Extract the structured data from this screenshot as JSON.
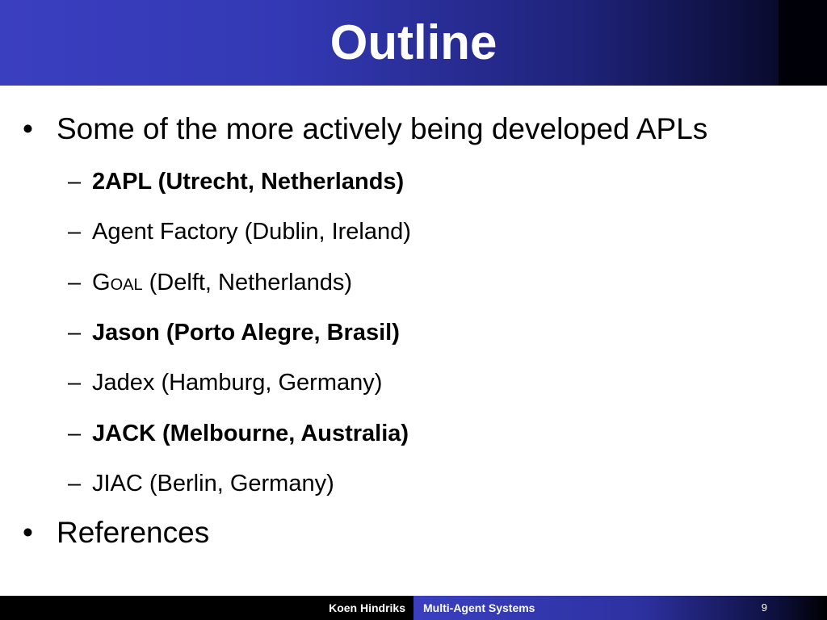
{
  "slide": {
    "title": "Outline",
    "bullets": [
      {
        "text": "Some of the more actively being developed APLs",
        "sub_items": [
          {
            "text": "2APL (Utrecht, Netherlands)",
            "bold": true
          },
          {
            "text": "Agent Factory (Dublin, Ireland)",
            "bold": false
          },
          {
            "name_first": "G",
            "name_rest": "oal",
            "text": " (Delft, Netherlands)",
            "bold": false
          },
          {
            "text": "Jason (Porto Alegre, Brasil)",
            "bold": true
          },
          {
            "text": "Jadex (Hamburg, Germany)",
            "bold": false
          },
          {
            "text": "JACK (Melbourne, Australia)",
            "bold": true
          },
          {
            "text": "JIAC (Berlin, Germany)",
            "bold": false
          }
        ]
      },
      {
        "text": "References",
        "sub_items": []
      }
    ],
    "bullet_symbol": "•",
    "dash_symbol": "–"
  },
  "footer": {
    "author": "Koen Hindriks",
    "course": "Multi-Agent Systems",
    "page_number": "9"
  },
  "colors": {
    "title_bar_start": "#3a3fc0",
    "title_bar_end": "#020312",
    "footer_background": "#000000",
    "title_text": "#ffffff"
  }
}
